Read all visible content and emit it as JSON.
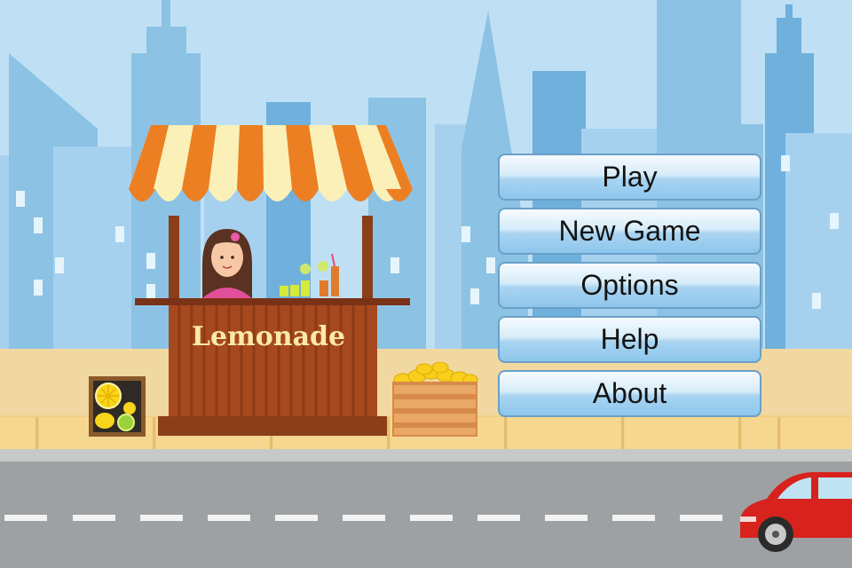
{
  "menu": {
    "play": "Play",
    "new_game": "New Game",
    "options": "Options",
    "help": "Help",
    "about": "About"
  },
  "stand": {
    "sign": "Lemonade"
  },
  "colors": {
    "sky": "#bfe0f4",
    "building": "#8cc2e4",
    "awning_orange": "#ec7f22",
    "awning_cream": "#fbf1b8",
    "stand_wood": "#a6491e",
    "button_blue": "#8dc6ec",
    "car": "#d8221d"
  },
  "icons": [
    "lemonade-stand-icon",
    "lemon-sign-icon",
    "lemon-crate-icon",
    "red-car-icon",
    "girl-vendor-icon"
  ]
}
